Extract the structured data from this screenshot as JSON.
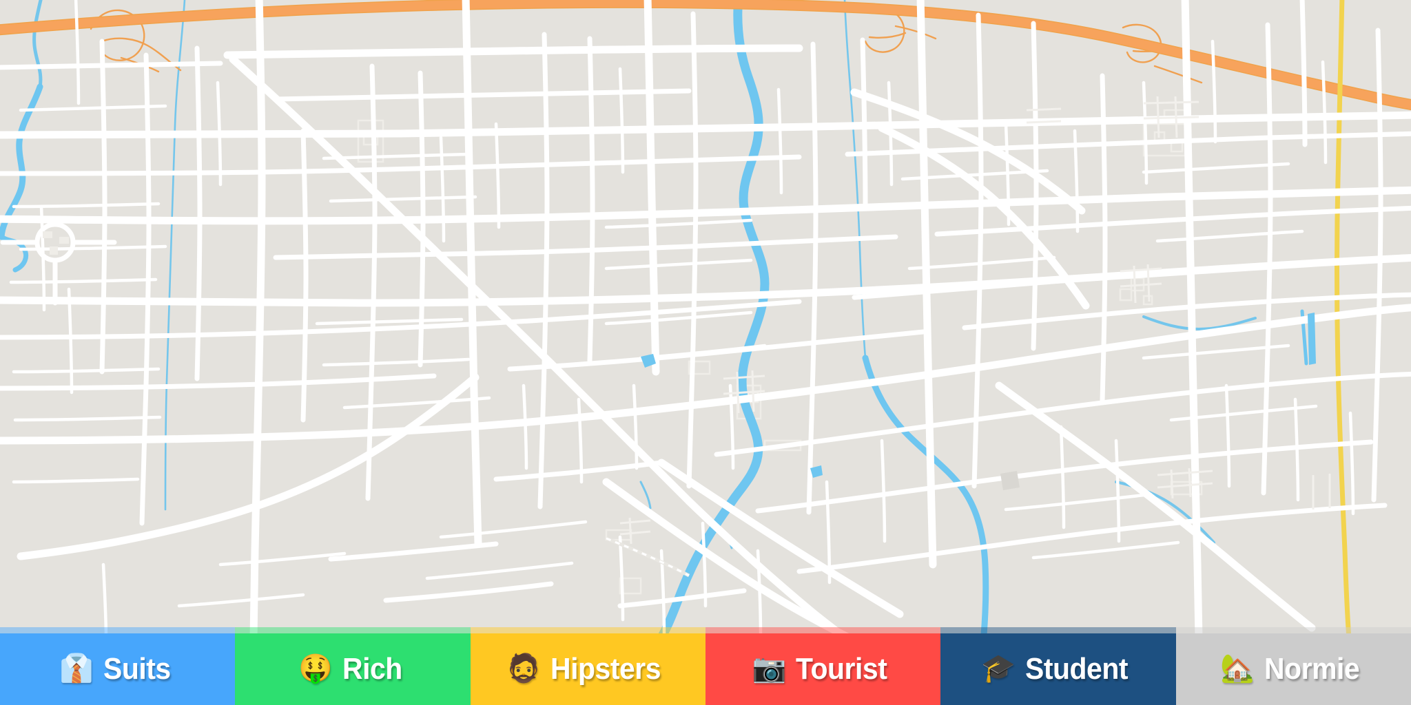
{
  "map": {
    "name": "city-street-map",
    "base_color": "#e4e2dd",
    "road_color": "#ffffff",
    "minor_road_color": "#f1efeb",
    "water_color": "#6ec6f0",
    "stream_color": "#72c5ec",
    "motorway_color": "#f7a35c",
    "motorway_casing_color": "#f0a24a",
    "trunk_color": "#f2d34e",
    "building_color": "#dedcd6"
  },
  "legend": {
    "name": "neighborhood-persona-legend",
    "segments": [
      {
        "id": "suits",
        "label": "Suits",
        "emoji": "👔",
        "emoji_name": "necktie-shirt-emoji",
        "color": "#47a6fc",
        "text_color": "#ffffff"
      },
      {
        "id": "rich",
        "label": "Rich",
        "emoji": "🤑",
        "emoji_name": "money-mouth-face-emoji",
        "color": "#2ddf70",
        "text_color": "#ffffff"
      },
      {
        "id": "hipsters",
        "label": "Hipsters",
        "emoji": "🧔",
        "emoji_name": "bearded-person-emoji",
        "color": "#ffc822",
        "text_color": "#ffffff"
      },
      {
        "id": "tourist",
        "label": "Tourist",
        "emoji": "📷",
        "emoji_name": "camera-emoji",
        "color": "#ff4a45",
        "text_color": "#ffffff"
      },
      {
        "id": "student",
        "label": "Student",
        "emoji": "🎓",
        "emoji_name": "graduation-cap-emoji",
        "color": "#1d5081",
        "text_color": "#ffffff"
      },
      {
        "id": "normie",
        "label": "Normie",
        "emoji": "🏡",
        "emoji_name": "house-with-garden-emoji",
        "color": "#cccccc",
        "text_color": "#ffffff"
      }
    ]
  }
}
